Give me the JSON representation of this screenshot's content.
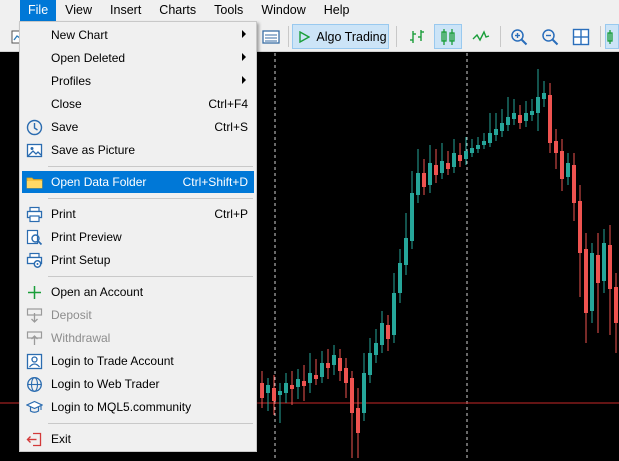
{
  "menubar": {
    "items": [
      {
        "label": "File",
        "name": "menu-file",
        "active": true
      },
      {
        "label": "View",
        "name": "menu-view"
      },
      {
        "label": "Insert",
        "name": "menu-insert"
      },
      {
        "label": "Charts",
        "name": "menu-charts"
      },
      {
        "label": "Tools",
        "name": "menu-tools"
      },
      {
        "label": "Window",
        "name": "menu-window"
      },
      {
        "label": "Help",
        "name": "menu-help"
      }
    ]
  },
  "toolbar": {
    "algo_trading_label": "Algo Trading"
  },
  "file_menu": {
    "items": [
      {
        "label": "New Chart",
        "submenu": true,
        "icon": "",
        "name": "menu-item-new-chart"
      },
      {
        "label": "Open Deleted",
        "submenu": true,
        "icon": "",
        "name": "menu-item-open-deleted"
      },
      {
        "label": "Profiles",
        "submenu": true,
        "icon": "",
        "name": "menu-item-profiles"
      },
      {
        "label": "Close",
        "shortcut": "Ctrl+F4",
        "icon": "",
        "name": "menu-item-close"
      },
      {
        "label": "Save",
        "shortcut": "Ctrl+S",
        "icon": "save-icon",
        "name": "menu-item-save"
      },
      {
        "label": "Save as Picture",
        "icon": "picture-icon",
        "name": "menu-item-save-as-picture"
      },
      {
        "sep": true
      },
      {
        "label": "Open Data Folder",
        "shortcut": "Ctrl+Shift+D",
        "icon": "folder-icon",
        "name": "menu-item-open-data-folder",
        "highlighted": true
      },
      {
        "sep": true
      },
      {
        "label": "Print",
        "shortcut": "Ctrl+P",
        "icon": "printer-icon",
        "name": "menu-item-print"
      },
      {
        "label": "Print Preview",
        "icon": "print-preview-icon",
        "name": "menu-item-print-preview"
      },
      {
        "label": "Print Setup",
        "icon": "print-setup-icon",
        "name": "menu-item-print-setup"
      },
      {
        "sep": true
      },
      {
        "label": "Open an Account",
        "icon": "plus-icon",
        "name": "menu-item-open-account"
      },
      {
        "label": "Deposit",
        "icon": "deposit-icon",
        "name": "menu-item-deposit",
        "disabled": true
      },
      {
        "label": "Withdrawal",
        "icon": "withdrawal-icon",
        "name": "menu-item-withdrawal",
        "disabled": true
      },
      {
        "label": "Login to Trade Account",
        "icon": "user-icon",
        "name": "menu-item-login-trade"
      },
      {
        "label": "Login to Web Trader",
        "icon": "globe-icon",
        "name": "menu-item-login-web"
      },
      {
        "label": "Login to MQL5.community",
        "icon": "mortarboard-icon",
        "name": "menu-item-login-mql5"
      },
      {
        "sep": true
      },
      {
        "label": "Exit",
        "icon": "exit-icon",
        "name": "menu-item-exit"
      }
    ]
  },
  "colors": {
    "bull": "#26a69a",
    "bear": "#ef5350",
    "accent": "#0078d7",
    "price_line": "#c62828"
  }
}
